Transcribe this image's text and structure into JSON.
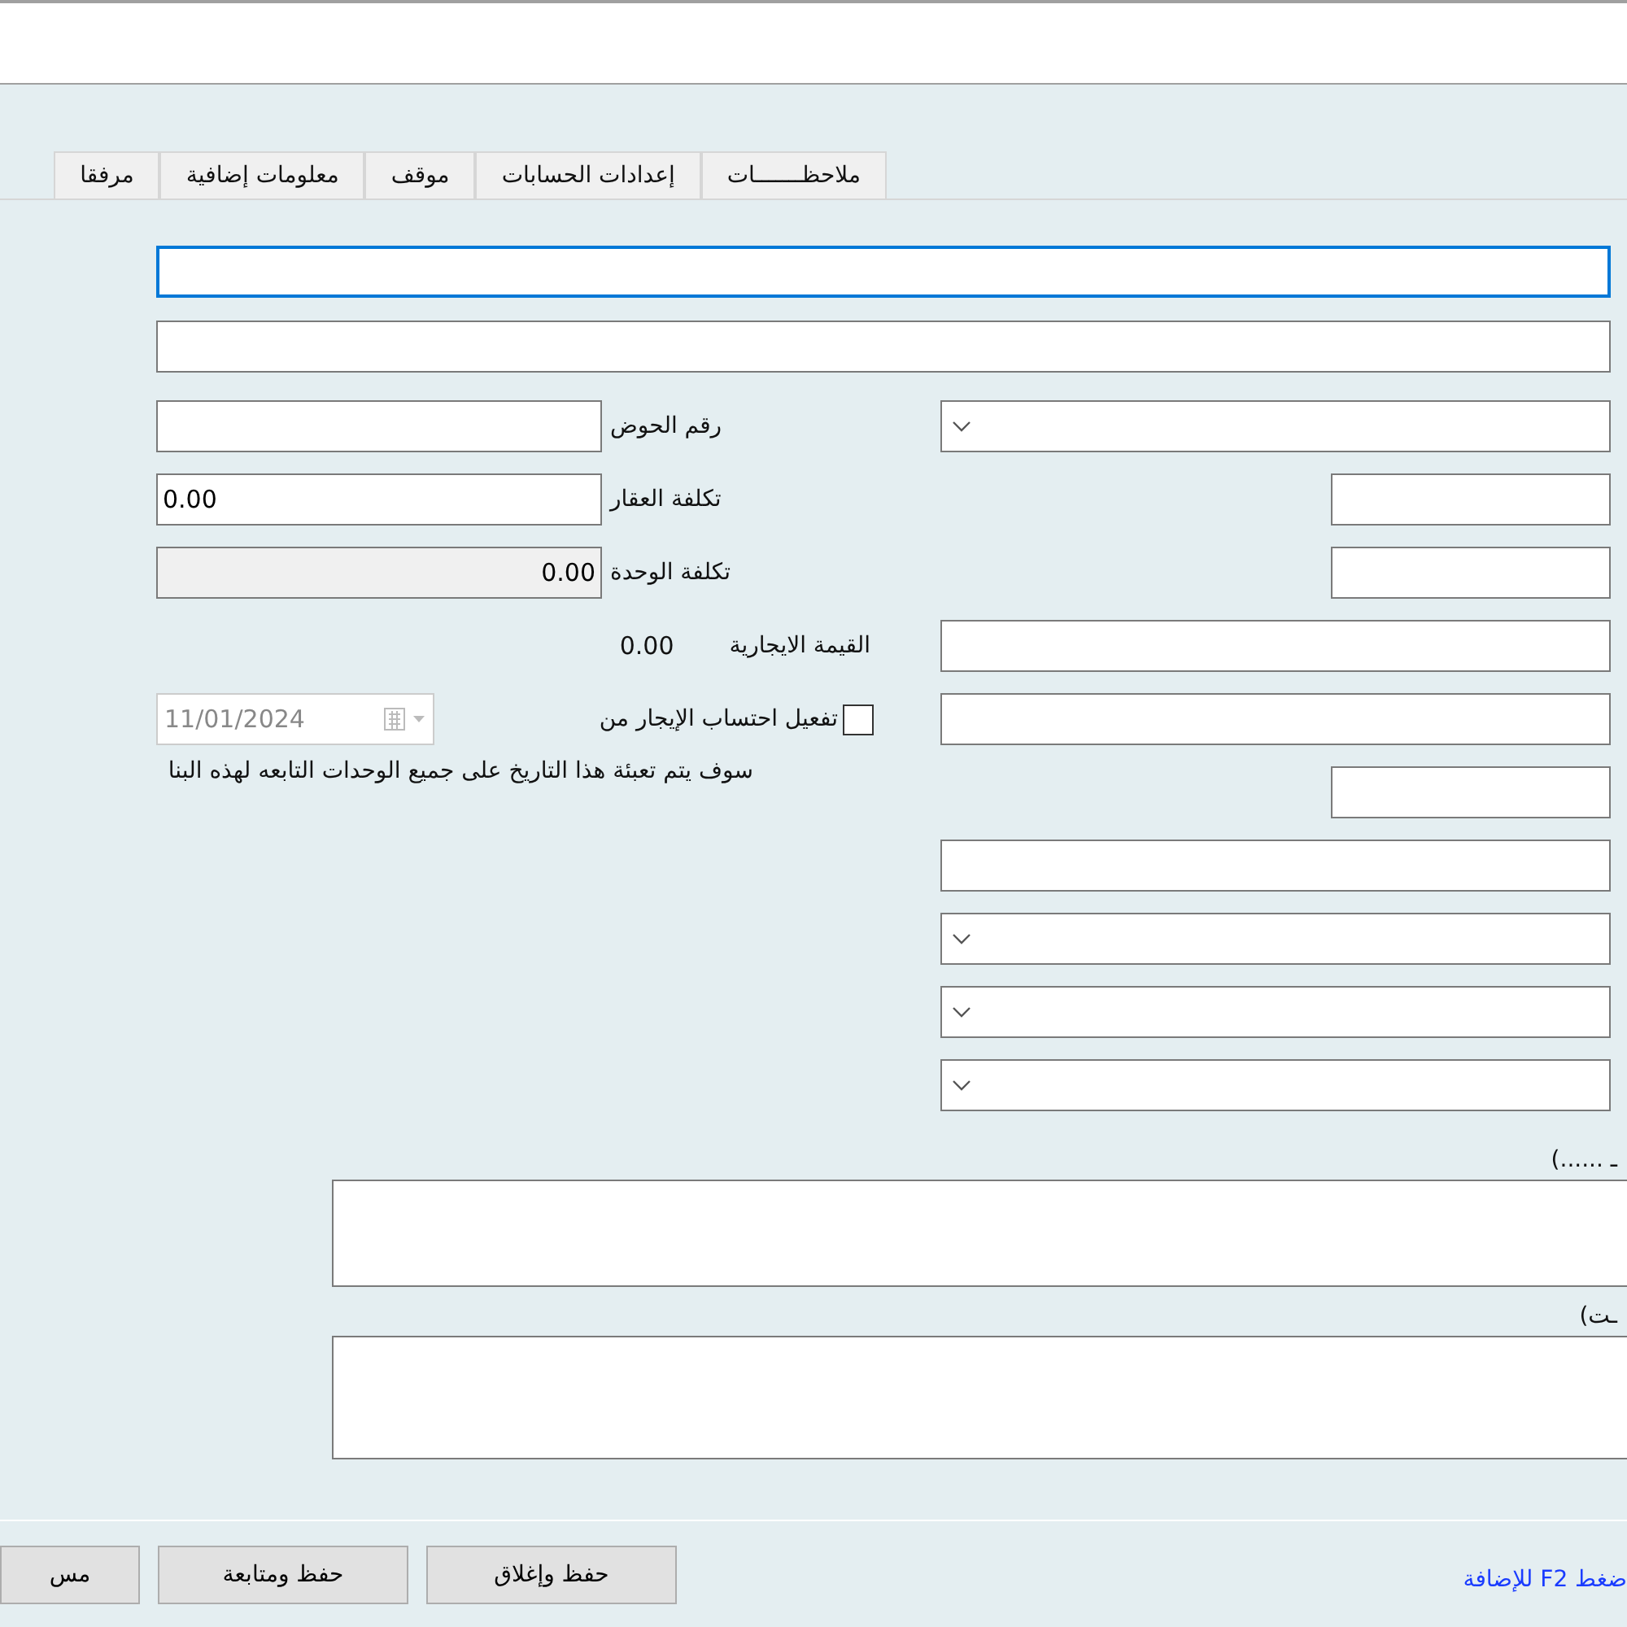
{
  "tabs": [
    {
      "label": "ملاحظـــــــات",
      "selected": false
    },
    {
      "label": "إعدادات الحسابات",
      "selected": false
    },
    {
      "label": "موقف",
      "selected": false
    },
    {
      "label": "معلومات إضافية",
      "selected": false
    },
    {
      "label": "مرفقا",
      "selected": false
    }
  ],
  "top_fields": [
    {
      "focused": true
    },
    {
      "focused": false
    }
  ],
  "left_fields": [
    {
      "label": "رقم الحوض",
      "disabled": false
    },
    {
      "label": "تكلفة العقار",
      "value": "0.00",
      "disabled": false
    },
    {
      "label": "تكلفة الوحدة",
      "value": "0.00",
      "disabled": true
    }
  ],
  "rental_value": {
    "label": "القيمة الايجارية",
    "value": "0.00"
  },
  "rent_start": {
    "label": "تفعيل احتساب الإيجار من",
    "checked": false,
    "date": "11/01/2024",
    "date_disabled": true
  },
  "note": "سوف يتم تعبئة هذا التاريخ على جميع الوحدات التابعه لهذه البنا",
  "right_fields": [
    {
      "kind": "dropdown"
    },
    {
      "kind": "short"
    },
    {
      "kind": "short"
    },
    {
      "kind": "text"
    },
    {
      "kind": "text"
    },
    {
      "kind": "short"
    },
    {
      "kind": "text"
    },
    {
      "kind": "dropdown"
    },
    {
      "kind": "dropdown"
    },
    {
      "kind": "dropdown"
    }
  ],
  "memo_fields": [
    {
      "label": "ـ ......)"
    },
    {
      "label": "ـت)"
    }
  ],
  "buttons": [
    {
      "label": "حفظ وإغلاق"
    },
    {
      "label": "حفظ ومتابعة"
    },
    {
      "label": "مس"
    }
  ],
  "hint_link": "ضغط F2 للإضافة"
}
